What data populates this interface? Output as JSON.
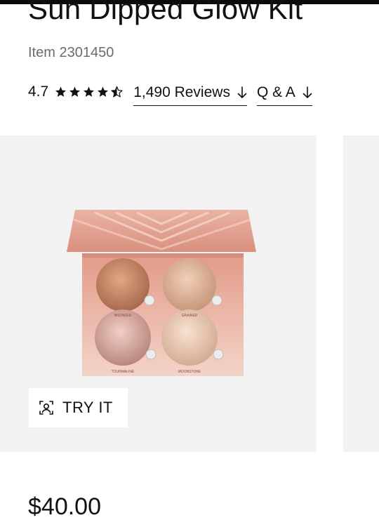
{
  "product": {
    "title": "Sun Dipped Glow Kit",
    "item_number": "Item 2301450",
    "price": "$40.00"
  },
  "rating": {
    "value": "4.7",
    "stars_filled": 4.5,
    "stars_total": 5,
    "reviews_link": "1,490 Reviews",
    "qa_link": "Q & A"
  },
  "media": {
    "try_it_label": "TRY IT",
    "shades": [
      "BRONZED",
      "GRAINED",
      "TOURMALINE",
      "MOONSTONE"
    ]
  },
  "colors": {
    "text": "#111111",
    "muted": "#6b6b6b",
    "card_bg": "#f2f2f2",
    "palette_lid": "#e8a898"
  },
  "icons": [
    "star-icon",
    "star-half-icon",
    "arrow-down-icon",
    "face-scan-icon"
  ]
}
